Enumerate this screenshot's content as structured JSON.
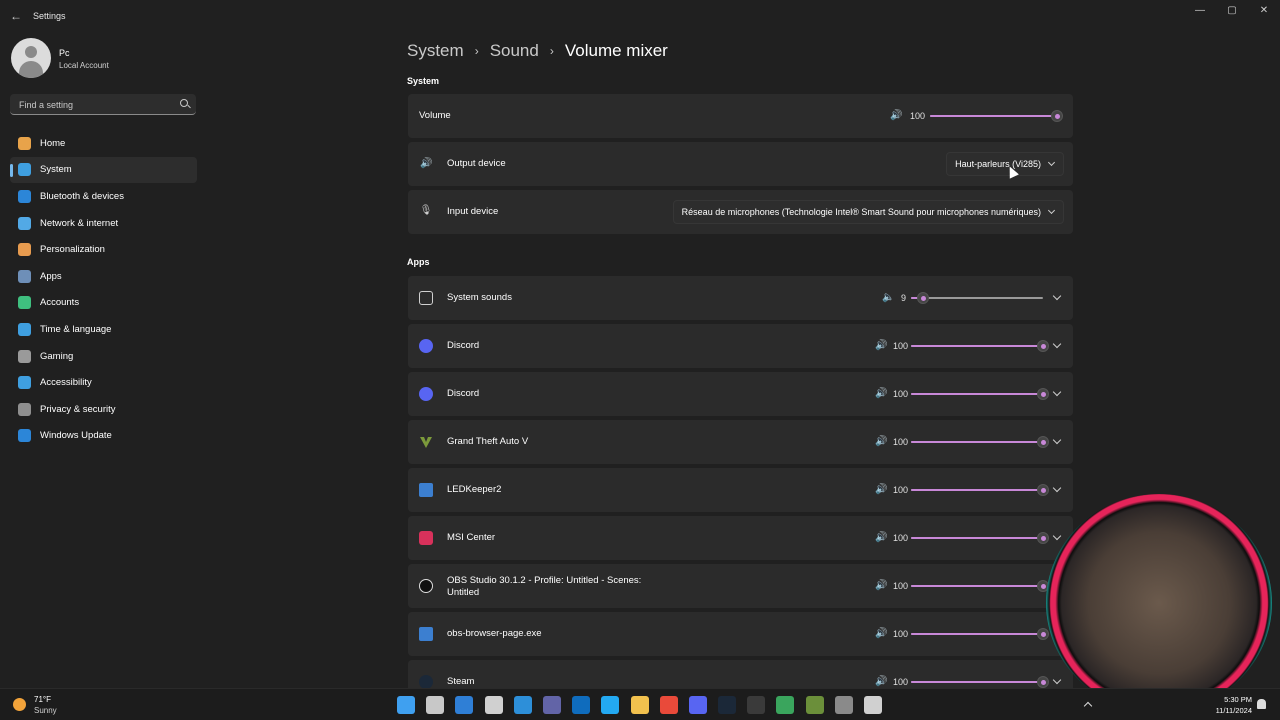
{
  "window": {
    "title": "Settings",
    "controls": [
      "minimize",
      "maximize",
      "close"
    ]
  },
  "user": {
    "name": "Pc",
    "account_type": "Local Account"
  },
  "search": {
    "placeholder": "Find a setting"
  },
  "sidebar": {
    "items": [
      {
        "label": "Home",
        "icon": "home-icon",
        "color": "#e8a34a",
        "active": false
      },
      {
        "label": "System",
        "icon": "system-icon",
        "color": "#3f9fe0",
        "active": true
      },
      {
        "label": "Bluetooth & devices",
        "icon": "bluetooth-icon",
        "color": "#2c86d8",
        "active": false
      },
      {
        "label": "Network & internet",
        "icon": "wifi-icon",
        "color": "#52a9e6",
        "active": false
      },
      {
        "label": "Personalization",
        "icon": "brush-icon",
        "color": "#e79b4f",
        "active": false
      },
      {
        "label": "Apps",
        "icon": "apps-icon",
        "color": "#6e8fb8",
        "active": false
      },
      {
        "label": "Accounts",
        "icon": "accounts-icon",
        "color": "#3fbf7f",
        "active": false
      },
      {
        "label": "Time & language",
        "icon": "globe-clock-icon",
        "color": "#3f9fe0",
        "active": false
      },
      {
        "label": "Gaming",
        "icon": "gamepad-icon",
        "color": "#9a9a9a",
        "active": false
      },
      {
        "label": "Accessibility",
        "icon": "accessibility-icon",
        "color": "#3f9fe0",
        "active": false
      },
      {
        "label": "Privacy & security",
        "icon": "shield-icon",
        "color": "#8f8f8f",
        "active": false
      },
      {
        "label": "Windows Update",
        "icon": "update-icon",
        "color": "#2c86d8",
        "active": false
      }
    ]
  },
  "breadcrumb": {
    "items": [
      "System",
      "Sound",
      "Volume mixer"
    ],
    "separator": "›"
  },
  "system_section": {
    "title": "System",
    "volume": {
      "label": "Volume",
      "value": 100,
      "value_text": "100",
      "icon": "speaker-icon"
    },
    "output": {
      "label": "Output device",
      "selected": "Haut-parleurs (Vi285)",
      "icon": "speaker-icon"
    },
    "input": {
      "label": "Input device",
      "selected": "Réseau de microphones (Technologie Intel® Smart Sound pour microphones numériques)",
      "icon": "microphone-icon"
    }
  },
  "apps_section": {
    "title": "Apps",
    "apps": [
      {
        "name": "System sounds",
        "value": 9,
        "value_text": "9",
        "icon": "system-sounds-icon"
      },
      {
        "name": "Discord",
        "value": 100,
        "value_text": "100",
        "icon": "discord-icon"
      },
      {
        "name": "Discord",
        "value": 100,
        "value_text": "100",
        "icon": "discord-icon"
      },
      {
        "name": "Grand Theft Auto V",
        "value": 100,
        "value_text": "100",
        "icon": "gta-icon"
      },
      {
        "name": "LEDKeeper2",
        "value": 100,
        "value_text": "100",
        "icon": "ledkeeper-icon"
      },
      {
        "name": "MSI Center",
        "value": 100,
        "value_text": "100",
        "icon": "msi-center-icon"
      },
      {
        "name": "OBS Studio 30.1.2 - Profile: Untitled - Scenes: Untitled",
        "value": 100,
        "value_text": "100",
        "icon": "obs-icon"
      },
      {
        "name": "obs-browser-page.exe",
        "value": 100,
        "value_text": "100",
        "icon": "browser-page-icon"
      },
      {
        "name": "Steam",
        "value": 100,
        "value_text": "100",
        "icon": "steam-icon"
      }
    ]
  },
  "colors": {
    "accent": "#c888d8",
    "card": "#2b2b2b",
    "background": "#202020"
  },
  "taskbar": {
    "weather": {
      "temp": "71°F",
      "desc": "Sunny"
    },
    "apps": [
      {
        "icon": "start-icon",
        "color": "#3fa0f0"
      },
      {
        "icon": "task-view-icon",
        "color": "#c8c8c8"
      },
      {
        "icon": "file-explorer-blue-icon",
        "color": "#2f7fd6"
      },
      {
        "icon": "clapper-icon",
        "color": "#d0d0d0"
      },
      {
        "icon": "edge-icon",
        "color": "#2d8fd9"
      },
      {
        "icon": "teams-icon",
        "color": "#6264a7"
      },
      {
        "icon": "outlook-icon",
        "color": "#0f6cbd"
      },
      {
        "icon": "vscode-icon",
        "color": "#23a9f2"
      },
      {
        "icon": "folder-icon",
        "color": "#f2c14e"
      },
      {
        "icon": "chrome-icon",
        "color": "#e94a3a"
      },
      {
        "icon": "discord-taskbar-icon",
        "color": "#5865f2"
      },
      {
        "icon": "steam-taskbar-icon",
        "color": "#1b2838"
      },
      {
        "icon": "obs-taskbar-icon",
        "color": "#3a3a3a"
      },
      {
        "icon": "chrome-dev-icon",
        "color": "#3aa55d"
      },
      {
        "icon": "gta-taskbar-icon",
        "color": "#6b8f3a"
      },
      {
        "icon": "settings-icon",
        "color": "#8a8a8a"
      },
      {
        "icon": "monitor-icon",
        "color": "#d0d0d0"
      }
    ],
    "time": "5:30 PM",
    "date": "11/11/2024"
  }
}
